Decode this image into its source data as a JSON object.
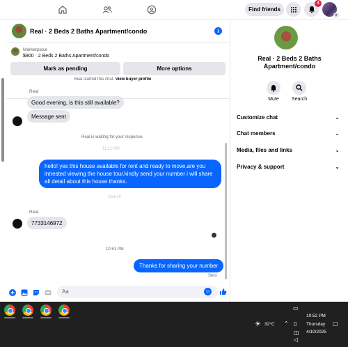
{
  "topnav": {
    "find_friends": "Find friends",
    "notification_count": "4",
    "icons": [
      "home-icon",
      "friends-icon",
      "groups-icon",
      "menu-grid-icon",
      "bell-icon",
      "profile-avatar"
    ]
  },
  "chat": {
    "title": "Real · 2 Beds 2 Baths Apartment/condo",
    "marketplace_label": "Marketplace",
    "listing": "$900 · 2 Beds 2 Baths Apartment/condo",
    "mark_pending": "Mark as pending",
    "more_options": "More options",
    "started_text": "Real started this chat.",
    "view_profile": "View buyer profile",
    "sender_name": "Real",
    "msg_1": "Good evening, is this still available?",
    "msg_2": "Message sent",
    "waiting": "Real is waiting for your response.",
    "faded_1": "11:11 PM",
    "out_msg": "hello! yes this house available for rent and ready to move.are you intrested viewing the house tour.kindly send your number i will share all detail about this house thanks.",
    "faded_2": "Search",
    "sender_name_2": "Real",
    "msg_3": "7733146972",
    "time": "10:51 PM",
    "out_msg_2": "Thanks for sharing your number",
    "status": "Sent",
    "placeholder": "Aa"
  },
  "side": {
    "title": "Real · 2 Beds 2 Baths Apartment/condo",
    "mute": "Mute",
    "search": "Search",
    "rows": [
      "Customize chat",
      "Chat members",
      "Media, files and links",
      "Privacy & support"
    ]
  },
  "taskbar": {
    "temperature": "32°C",
    "time": "10:52 PM",
    "day": "Thursday",
    "date": "4/10/2025"
  },
  "colors": {
    "accent": "#0866ff",
    "bubble_in": "#e4e6eb",
    "taskbar": "#202020"
  }
}
